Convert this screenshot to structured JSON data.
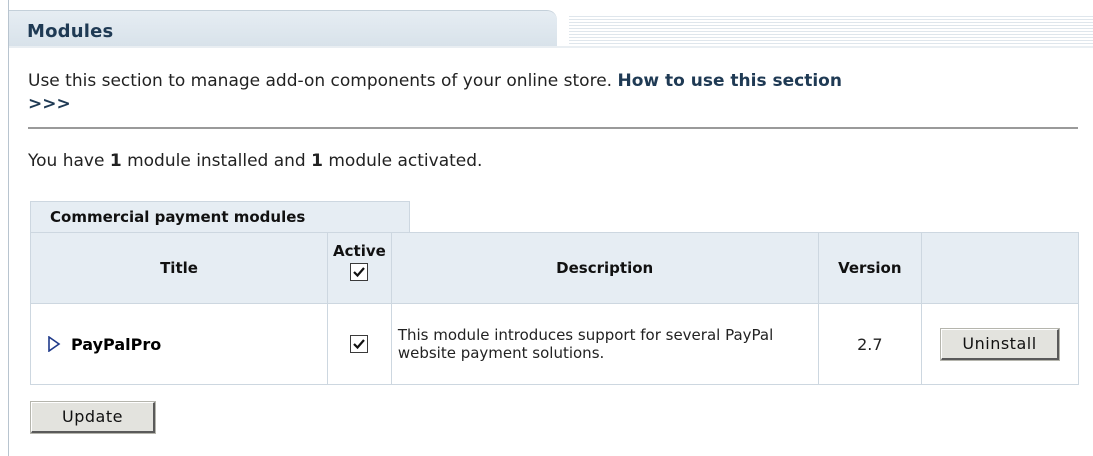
{
  "header": {
    "title": "Modules"
  },
  "intro": {
    "text": "Use this section to manage add-on components of your online store.",
    "link_label": "How to use this section",
    "more_label": ">>>"
  },
  "summary": {
    "prefix": "You have ",
    "installed_count": "1",
    "middle": " module installed and ",
    "activated_count": "1",
    "suffix": " module activated."
  },
  "section": {
    "tab_label": "Commercial payment modules"
  },
  "table": {
    "headers": {
      "title": "Title",
      "active": "Active",
      "description": "Description",
      "version": "Version"
    },
    "header_active_checked": true,
    "rows": [
      {
        "title": "PayPalPro",
        "active": true,
        "description": "This module introduces support for several PayPal website payment solutions.",
        "version": "2.7",
        "action_label": "Uninstall"
      }
    ]
  },
  "buttons": {
    "update_label": "Update"
  },
  "icons": {
    "expand": "triangle-right-icon",
    "checkmark": "checkmark-icon"
  },
  "colors": {
    "accent": "#1f3a54",
    "header_bg": "#e6edf3",
    "border": "#cdd7e0"
  }
}
